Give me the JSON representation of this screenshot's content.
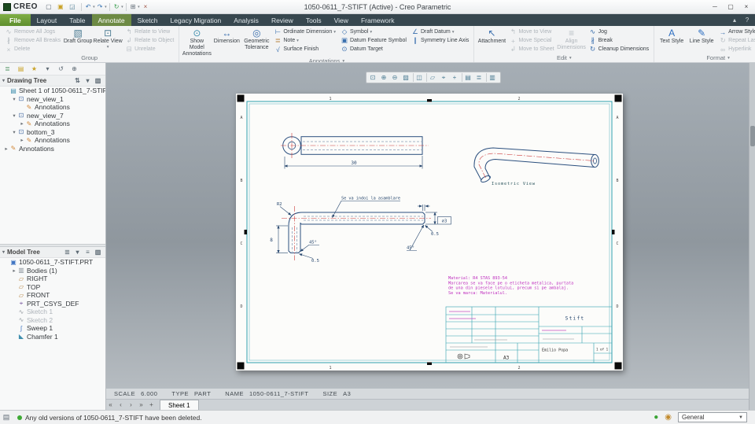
{
  "titlebar": {
    "brand": "CREO",
    "title": "1050-0611_7-STIFT (Active) - Creo Parametric",
    "quick_access": [
      {
        "n": "new-icon"
      },
      {
        "n": "open-icon"
      },
      {
        "n": "save-icon"
      },
      {
        "n": "sep"
      },
      {
        "n": "undo-icon",
        "caret": true
      },
      {
        "n": "redo-icon",
        "caret": true
      },
      {
        "n": "sep"
      },
      {
        "n": "regenerate-icon",
        "caret": true
      },
      {
        "n": "sep"
      },
      {
        "n": "windows-icon",
        "caret": true
      },
      {
        "n": "close-window-icon"
      }
    ],
    "window_controls": [
      "minimize-icon",
      "maximize-icon",
      "close-icon"
    ]
  },
  "tabs": [
    {
      "label": "File",
      "type": "file"
    },
    {
      "label": "Layout"
    },
    {
      "label": "Table"
    },
    {
      "label": "Annotate",
      "active": true
    },
    {
      "label": "Sketch"
    },
    {
      "label": "Legacy Migration"
    },
    {
      "label": "Analysis"
    },
    {
      "label": "Review"
    },
    {
      "label": "Tools"
    },
    {
      "label": "View"
    },
    {
      "label": "Framework"
    }
  ],
  "ribbon": {
    "groups": [
      {
        "label": "Group",
        "caret": false,
        "cols": [
          {
            "type": "small",
            "items": [
              {
                "t": "Remove All Jogs",
                "icon": "remove-all-jogs-icon",
                "dis": true
              },
              {
                "t": "Remove All Breaks",
                "icon": "remove-all-breaks-icon",
                "dis": true
              },
              {
                "t": "Delete",
                "icon": "delete-icon",
                "dis": true
              }
            ]
          },
          {
            "type": "big",
            "items": [
              {
                "t": "Draft Group",
                "icon": "draft-group-icon"
              },
              {
                "t": "Relate View",
                "icon": "relate-view-icon",
                "caret": true
              }
            ]
          },
          {
            "type": "small",
            "items": [
              {
                "t": "Relate to View",
                "icon": "relate-to-view-icon",
                "dis": true
              },
              {
                "t": "Relate to Object",
                "icon": "relate-to-object-icon",
                "dis": true
              },
              {
                "t": "Unrelate",
                "icon": "unrelate-icon",
                "dis": true
              }
            ]
          }
        ]
      },
      {
        "label": "Annotations",
        "caret": true,
        "cols": [
          {
            "type": "big",
            "items": [
              {
                "t": "Show Model Annotations",
                "icon": "show-model-annotations-icon"
              },
              {
                "t": "Dimension",
                "icon": "dimension-icon"
              },
              {
                "t": "Geometric Tolerance",
                "icon": "geometric-tolerance-icon"
              }
            ]
          },
          {
            "type": "small",
            "items": [
              {
                "t": "Ordinate Dimension",
                "icon": "ordinate-dimension-icon",
                "caret": true
              },
              {
                "t": "Note",
                "icon": "note-icon",
                "caret": true
              },
              {
                "t": "Surface Finish",
                "icon": "surface-finish-icon"
              }
            ]
          },
          {
            "type": "small",
            "items": [
              {
                "t": "Symbol",
                "icon": "symbol-icon",
                "caret": true
              },
              {
                "t": "Datum Feature Symbol",
                "icon": "datum-feature-symbol-icon"
              },
              {
                "t": "Datum Target",
                "icon": "datum-target-icon"
              }
            ]
          },
          {
            "type": "small",
            "items": [
              {
                "t": "Draft Datum",
                "icon": "draft-datum-icon",
                "caret": true
              },
              {
                "t": "Symmetry Line Axis",
                "icon": "symmetry-line-axis-icon"
              }
            ]
          }
        ]
      },
      {
        "label": "Edit",
        "caret": true,
        "cols": [
          {
            "type": "big",
            "items": [
              {
                "t": "Attachment",
                "icon": "attachment-icon"
              }
            ]
          },
          {
            "type": "small",
            "items": [
              {
                "t": "Move to View",
                "icon": "move-to-view-icon",
                "dis": true
              },
              {
                "t": "Move Special",
                "icon": "move-special-icon",
                "dis": true
              },
              {
                "t": "Move to Sheet",
                "icon": "move-to-sheet-icon",
                "dis": true
              }
            ]
          },
          {
            "type": "big",
            "items": [
              {
                "t": "Align Dimensions",
                "icon": "align-dimensions-icon",
                "dis": true
              }
            ]
          },
          {
            "type": "small",
            "items": [
              {
                "t": "Jog",
                "icon": "jog-icon"
              },
              {
                "t": "Break",
                "icon": "break-icon"
              },
              {
                "t": "Cleanup Dimensions",
                "icon": "cleanup-dimensions-icon"
              }
            ]
          }
        ]
      },
      {
        "label": "Format",
        "caret": true,
        "cols": [
          {
            "type": "big",
            "items": [
              {
                "t": "Text Style",
                "icon": "text-style-icon"
              },
              {
                "t": "Line Style",
                "icon": "line-style-icon"
              }
            ]
          },
          {
            "type": "small",
            "items": [
              {
                "t": "Arrow Style",
                "icon": "arrow-style-icon",
                "caret": true
              },
              {
                "t": "Repeat Last Format",
                "icon": "repeat-last-format-icon",
                "dis": true
              },
              {
                "t": "Hyperlink",
                "icon": "hyperlink-icon",
                "dis": true
              }
            ]
          }
        ]
      }
    ]
  },
  "navigator_toolbar": [
    "model-tree-panel-icon",
    "folder-browser-icon",
    "favorites-icon",
    "dropdown-caret-icon",
    "history-icon",
    "connections-icon"
  ],
  "drawing_tree": {
    "header": "Drawing Tree",
    "header_icons": [
      "swap-icon",
      "filter-caret-icon",
      "columns-icon"
    ],
    "items": [
      {
        "label": "Sheet 1 of 1050-0611_7-STIFT.DRW",
        "icon": "sheet-icon",
        "level": 0,
        "caret": "none"
      },
      {
        "label": "new_view_1",
        "icon": "view-icon",
        "level": 1,
        "caret": "open"
      },
      {
        "label": "Annotations",
        "icon": "annotations-icon",
        "level": 2,
        "caret": "none"
      },
      {
        "label": "new_view_7",
        "icon": "view-icon",
        "level": 1,
        "caret": "open"
      },
      {
        "label": "Annotations",
        "icon": "annotations-icon",
        "level": 2,
        "caret": "closed"
      },
      {
        "label": "bottom_3",
        "icon": "view-icon",
        "level": 1,
        "caret": "open"
      },
      {
        "label": "Annotations",
        "icon": "annotations-icon",
        "level": 2,
        "caret": "closed"
      },
      {
        "label": "Annotations",
        "icon": "annotations-icon",
        "level": 0,
        "caret": "closed"
      }
    ]
  },
  "model_tree": {
    "header": "Model Tree",
    "header_icons": [
      "list-icon",
      "filter-caret-icon",
      "settings-icon",
      "columns-icon"
    ],
    "items": [
      {
        "label": "1050-0611_7-STIFT.PRT",
        "icon": "part-icon",
        "level": 0,
        "caret": "none"
      },
      {
        "label": "Bodies (1)",
        "icon": "bodies-folder-icon",
        "level": 1,
        "caret": "closed"
      },
      {
        "label": "RIGHT",
        "icon": "datum-plane-icon",
        "level": 1,
        "caret": "none"
      },
      {
        "label": "TOP",
        "icon": "datum-plane-icon",
        "level": 1,
        "caret": "none"
      },
      {
        "label": "FRONT",
        "icon": "datum-plane-icon",
        "level": 1,
        "caret": "none"
      },
      {
        "label": "PRT_CSYS_DEF",
        "icon": "csys-icon",
        "level": 1,
        "caret": "none"
      },
      {
        "label": "Sketch 1",
        "icon": "sketch-icon",
        "level": 1,
        "caret": "none",
        "disabled": true
      },
      {
        "label": "Sketch 2",
        "icon": "sketch-icon",
        "level": 1,
        "caret": "none",
        "disabled": true
      },
      {
        "label": "Sweep 1",
        "icon": "sweep-icon",
        "level": 1,
        "caret": "none"
      },
      {
        "label": "Chamfer 1",
        "icon": "chamfer-icon",
        "level": 1,
        "caret": "none"
      }
    ]
  },
  "graphics_toolbar": [
    "refit-icon",
    "zoom-in-icon",
    "zoom-out-icon",
    "repaint-icon",
    "sep",
    "display-style-icon",
    "sep",
    "datum-display-icon",
    "annotation-display-icon",
    "spin-center-icon",
    "sep",
    "saved-views-icon",
    "view-manager-icon",
    "sep",
    "layers-icon"
  ],
  "sheet": {
    "zone_letters": [
      "A",
      "B",
      "C",
      "D"
    ],
    "zone_numbers": [
      "1",
      "2"
    ],
    "front_view": {
      "dim_length": "30"
    },
    "iso_view": {
      "label": "Isometric View"
    },
    "bent_view": {
      "note": "Se va indoi la asamblare",
      "dim_radius": "R2",
      "dim_height": "8",
      "chamfer_angle_left": "45°",
      "chamfer_depth_left": "0.5",
      "chamfer_angle_right": "45°",
      "chamfer_depth_right": "0.5",
      "dim_diameter": "⌀3"
    },
    "material_note": [
      "Material: R4 STAS 893-54",
      "Marcarea se va face pe o eticheta metalica, purtata",
      "de una din piesele lotului, precum si pe ambalaj.",
      "Se va marca: Materialul."
    ],
    "title_block": {
      "part_name": "Stift",
      "drawn_by": "Emilio Popa",
      "format": "A3",
      "sheet_info": "1 of 1"
    }
  },
  "scale_bar": {
    "scale_label": "SCALE",
    "scale_value": "6.000",
    "type_label": "TYPE",
    "type_value": "PART",
    "name_label": "NAME",
    "name_value": "1050-0611_7-STIFT",
    "size_label": "SIZE",
    "size_value": "A3"
  },
  "sheet_tabs": {
    "nav": [
      "go-first-icon",
      "go-prev-icon",
      "go-next-icon",
      "go-last-icon",
      "add-sheet-icon"
    ],
    "tabs": [
      {
        "label": "Sheet 1",
        "active": true
      }
    ]
  },
  "message_bar": {
    "message": "Any old versions of 1050-0611_7-STIFT have been deleted.",
    "status_icons": [
      "model-status-icon",
      "notification-icon"
    ]
  },
  "bottom_bar": {
    "filter_value": "General"
  }
}
